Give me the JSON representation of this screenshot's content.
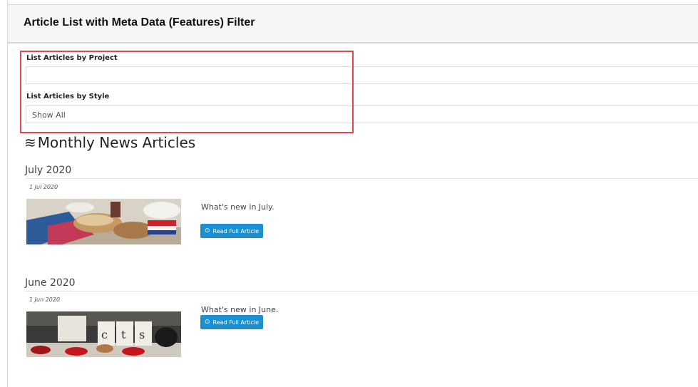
{
  "panel": {
    "title": "Article List with Meta Data (Features) Filter"
  },
  "filters": {
    "project": {
      "label": "List Articles by Project",
      "value": ""
    },
    "style": {
      "label": "List Articles by Style",
      "value": "Show All"
    }
  },
  "section": {
    "icon": "≋",
    "title": "Monthly News Articles"
  },
  "months": [
    {
      "heading": "July 2020",
      "date": "1 Jul 2020",
      "description": "What's new in July.",
      "button_label": "Read Full Article"
    },
    {
      "heading": "June 2020",
      "date": "1 Jun 2020",
      "description": "What's new in June.",
      "button_label": "Read Full Article"
    }
  ],
  "colors": {
    "accent": "#1a8fd2",
    "highlight": "#e0464a"
  },
  "icons": {
    "button_icon": "circle-arrow-icon"
  }
}
